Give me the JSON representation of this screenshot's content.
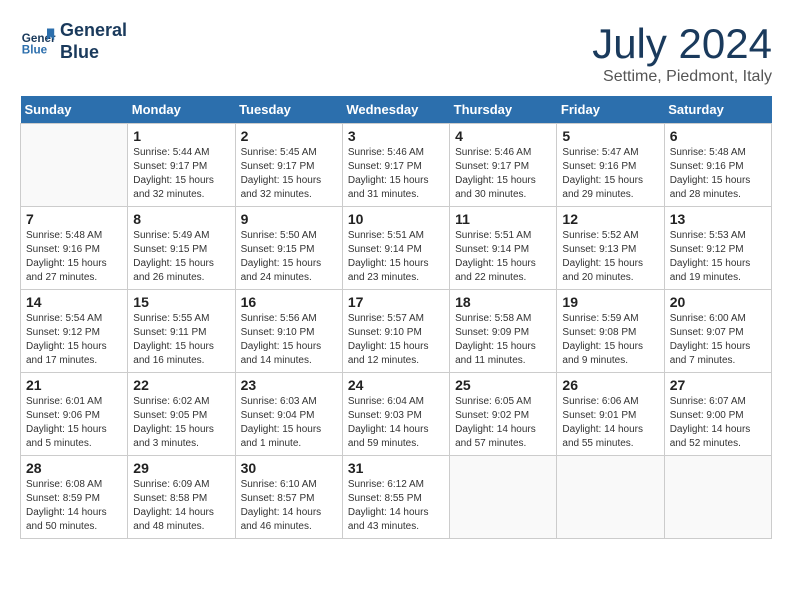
{
  "logo": {
    "line1": "General",
    "line2": "Blue"
  },
  "title": "July 2024",
  "subtitle": "Settime, Piedmont, Italy",
  "weekdays": [
    "Sunday",
    "Monday",
    "Tuesday",
    "Wednesday",
    "Thursday",
    "Friday",
    "Saturday"
  ],
  "weeks": [
    [
      {
        "day": "",
        "info": ""
      },
      {
        "day": "1",
        "info": "Sunrise: 5:44 AM\nSunset: 9:17 PM\nDaylight: 15 hours\nand 32 minutes."
      },
      {
        "day": "2",
        "info": "Sunrise: 5:45 AM\nSunset: 9:17 PM\nDaylight: 15 hours\nand 32 minutes."
      },
      {
        "day": "3",
        "info": "Sunrise: 5:46 AM\nSunset: 9:17 PM\nDaylight: 15 hours\nand 31 minutes."
      },
      {
        "day": "4",
        "info": "Sunrise: 5:46 AM\nSunset: 9:17 PM\nDaylight: 15 hours\nand 30 minutes."
      },
      {
        "day": "5",
        "info": "Sunrise: 5:47 AM\nSunset: 9:16 PM\nDaylight: 15 hours\nand 29 minutes."
      },
      {
        "day": "6",
        "info": "Sunrise: 5:48 AM\nSunset: 9:16 PM\nDaylight: 15 hours\nand 28 minutes."
      }
    ],
    [
      {
        "day": "7",
        "info": "Sunrise: 5:48 AM\nSunset: 9:16 PM\nDaylight: 15 hours\nand 27 minutes."
      },
      {
        "day": "8",
        "info": "Sunrise: 5:49 AM\nSunset: 9:15 PM\nDaylight: 15 hours\nand 26 minutes."
      },
      {
        "day": "9",
        "info": "Sunrise: 5:50 AM\nSunset: 9:15 PM\nDaylight: 15 hours\nand 24 minutes."
      },
      {
        "day": "10",
        "info": "Sunrise: 5:51 AM\nSunset: 9:14 PM\nDaylight: 15 hours\nand 23 minutes."
      },
      {
        "day": "11",
        "info": "Sunrise: 5:51 AM\nSunset: 9:14 PM\nDaylight: 15 hours\nand 22 minutes."
      },
      {
        "day": "12",
        "info": "Sunrise: 5:52 AM\nSunset: 9:13 PM\nDaylight: 15 hours\nand 20 minutes."
      },
      {
        "day": "13",
        "info": "Sunrise: 5:53 AM\nSunset: 9:12 PM\nDaylight: 15 hours\nand 19 minutes."
      }
    ],
    [
      {
        "day": "14",
        "info": "Sunrise: 5:54 AM\nSunset: 9:12 PM\nDaylight: 15 hours\nand 17 minutes."
      },
      {
        "day": "15",
        "info": "Sunrise: 5:55 AM\nSunset: 9:11 PM\nDaylight: 15 hours\nand 16 minutes."
      },
      {
        "day": "16",
        "info": "Sunrise: 5:56 AM\nSunset: 9:10 PM\nDaylight: 15 hours\nand 14 minutes."
      },
      {
        "day": "17",
        "info": "Sunrise: 5:57 AM\nSunset: 9:10 PM\nDaylight: 15 hours\nand 12 minutes."
      },
      {
        "day": "18",
        "info": "Sunrise: 5:58 AM\nSunset: 9:09 PM\nDaylight: 15 hours\nand 11 minutes."
      },
      {
        "day": "19",
        "info": "Sunrise: 5:59 AM\nSunset: 9:08 PM\nDaylight: 15 hours\nand 9 minutes."
      },
      {
        "day": "20",
        "info": "Sunrise: 6:00 AM\nSunset: 9:07 PM\nDaylight: 15 hours\nand 7 minutes."
      }
    ],
    [
      {
        "day": "21",
        "info": "Sunrise: 6:01 AM\nSunset: 9:06 PM\nDaylight: 15 hours\nand 5 minutes."
      },
      {
        "day": "22",
        "info": "Sunrise: 6:02 AM\nSunset: 9:05 PM\nDaylight: 15 hours\nand 3 minutes."
      },
      {
        "day": "23",
        "info": "Sunrise: 6:03 AM\nSunset: 9:04 PM\nDaylight: 15 hours\nand 1 minute."
      },
      {
        "day": "24",
        "info": "Sunrise: 6:04 AM\nSunset: 9:03 PM\nDaylight: 14 hours\nand 59 minutes."
      },
      {
        "day": "25",
        "info": "Sunrise: 6:05 AM\nSunset: 9:02 PM\nDaylight: 14 hours\nand 57 minutes."
      },
      {
        "day": "26",
        "info": "Sunrise: 6:06 AM\nSunset: 9:01 PM\nDaylight: 14 hours\nand 55 minutes."
      },
      {
        "day": "27",
        "info": "Sunrise: 6:07 AM\nSunset: 9:00 PM\nDaylight: 14 hours\nand 52 minutes."
      }
    ],
    [
      {
        "day": "28",
        "info": "Sunrise: 6:08 AM\nSunset: 8:59 PM\nDaylight: 14 hours\nand 50 minutes."
      },
      {
        "day": "29",
        "info": "Sunrise: 6:09 AM\nSunset: 8:58 PM\nDaylight: 14 hours\nand 48 minutes."
      },
      {
        "day": "30",
        "info": "Sunrise: 6:10 AM\nSunset: 8:57 PM\nDaylight: 14 hours\nand 46 minutes."
      },
      {
        "day": "31",
        "info": "Sunrise: 6:12 AM\nSunset: 8:55 PM\nDaylight: 14 hours\nand 43 minutes."
      },
      {
        "day": "",
        "info": ""
      },
      {
        "day": "",
        "info": ""
      },
      {
        "day": "",
        "info": ""
      }
    ]
  ]
}
